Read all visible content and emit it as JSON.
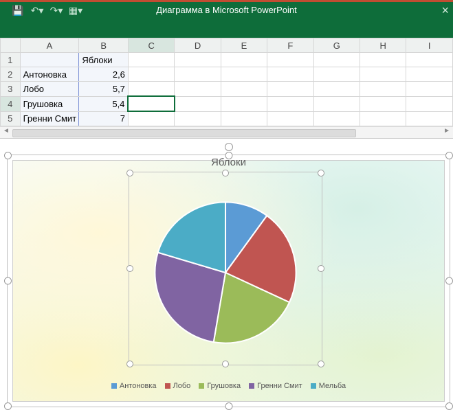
{
  "window": {
    "title": "Диаграмма в Microsoft PowerPoint"
  },
  "qat": {
    "save": "save",
    "undo": "undo",
    "redo": "redo",
    "custom": "custom"
  },
  "sheet": {
    "columns": [
      "A",
      "B",
      "C",
      "D",
      "E",
      "F",
      "G",
      "H",
      "I"
    ],
    "header_row": "1",
    "b1": "Яблоки",
    "rows": [
      {
        "n": "2",
        "a": "Антоновка",
        "b": "2,6"
      },
      {
        "n": "3",
        "a": "Лобо",
        "b": "5,7"
      },
      {
        "n": "4",
        "a": "Грушовка",
        "b": "5,4"
      },
      {
        "n": "5",
        "a": "Гренни Смит",
        "b": "7"
      }
    ]
  },
  "chart_data": {
    "type": "pie",
    "title": "Яблоки",
    "series": [
      {
        "name": "Антоновка",
        "value": 2.6,
        "color": "#5b9bd5"
      },
      {
        "name": "Лобо",
        "value": 5.7,
        "color": "#c05551"
      },
      {
        "name": "Грушовка",
        "value": 5.4,
        "color": "#9bbb59"
      },
      {
        "name": "Гренни Смит",
        "value": 7,
        "color": "#8064a2"
      },
      {
        "name": "Мельба",
        "value": 5.3,
        "color": "#4bacc6"
      }
    ],
    "legend_position": "bottom"
  },
  "legend_labels": {
    "l0": "Антоновка",
    "l1": "Лобо",
    "l2": "Грушовка",
    "l3": "Гренни Смит",
    "l4": "Мельба"
  }
}
